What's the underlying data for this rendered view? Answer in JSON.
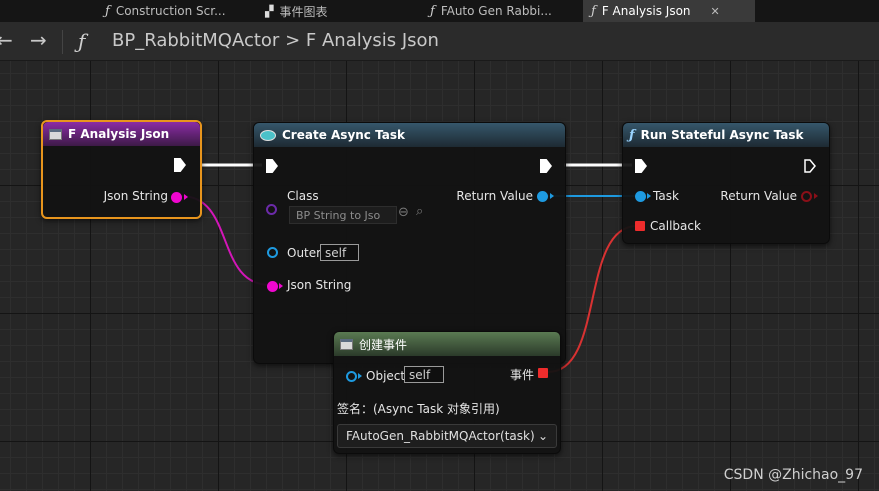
{
  "tabs": [
    {
      "label": "Construction Scr...",
      "icon": "function-icon"
    },
    {
      "label": "事件图表",
      "icon": "event-graph-icon"
    },
    {
      "label": "FAuto Gen Rabbi...",
      "icon": "function-icon"
    },
    {
      "label": "F Analysis Json",
      "icon": "function-icon",
      "active": true,
      "close": "✕"
    }
  ],
  "nav": {
    "back": "←",
    "forward": "→",
    "func_symbol": "ƒ",
    "breadcrumb_root": "BP_RabbitMQActor",
    "breadcrumb_sep": ">",
    "breadcrumb_current": "F Analysis Json"
  },
  "nodes": {
    "analysis": {
      "title": "F Analysis Json",
      "out_json": "Json String"
    },
    "create": {
      "title": "Create Async Task",
      "class_label": "Class",
      "class_value": "BP String to Jso",
      "return_label": "Return Value",
      "outer_label": "Outer",
      "outer_value": "self",
      "json_label": "Json String"
    },
    "run": {
      "title": "Run Stateful Async Task",
      "task_label": "Task",
      "return_label": "Return Value",
      "callback_label": "Callback"
    },
    "event": {
      "title": "创建事件",
      "object_label": "Object",
      "object_value": "self",
      "event_label": "事件",
      "signature": "签名：(Async Task 对象引用)",
      "selected_function": "FAutoGen_RabbitMQActor(task)"
    }
  },
  "colors": {
    "exec": "#ffffff",
    "object": "#1e9ae0",
    "string": "#f006cf",
    "delegate": "#ee2c2c",
    "selection": "#e8951d"
  },
  "watermark": "CSDN @Zhichao_97"
}
